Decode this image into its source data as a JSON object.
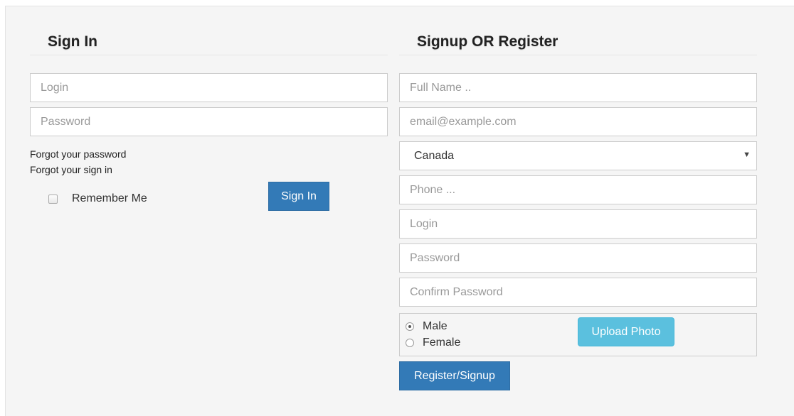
{
  "signin": {
    "heading": "Sign In",
    "login_placeholder": "Login",
    "password_placeholder": "Password",
    "forgot_password": "Forgot your password",
    "forgot_signin": "Forgot your sign in",
    "remember_label": "Remember Me",
    "remember_checked": false,
    "button_label": "Sign In"
  },
  "signup": {
    "heading": "Signup OR Register",
    "fullname_placeholder": "Full Name ..",
    "email_placeholder": "email@example.com",
    "country_selected": "Canada",
    "phone_placeholder": "Phone ...",
    "login_placeholder": "Login",
    "password_placeholder": "Password",
    "confirm_password_placeholder": "Confirm Password",
    "gender_male": "Male",
    "gender_female": "Female",
    "gender_selected": "Male",
    "upload_label": "Upload Photo",
    "register_label": "Register/Signup"
  },
  "colors": {
    "primary": "#337ab7",
    "info": "#5bc0de",
    "panel_bg": "#f5f5f5"
  }
}
